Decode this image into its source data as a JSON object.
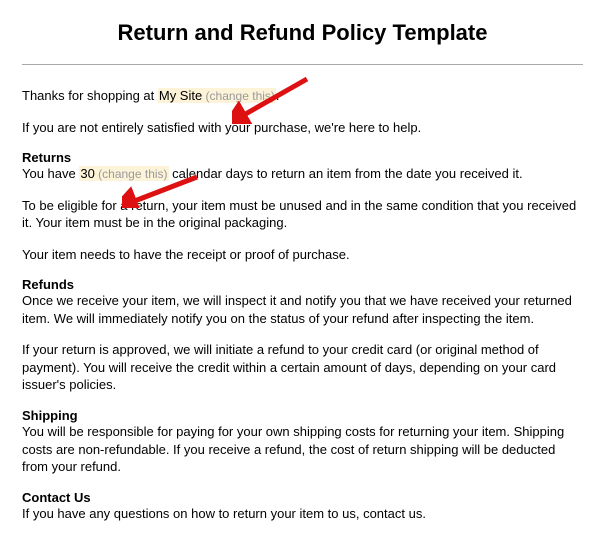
{
  "title": "Return and Refund Policy Template",
  "intro": {
    "prefix": "Thanks for shopping at ",
    "site_name": "My Site",
    "change_hint": " (change this)",
    "suffix": "."
  },
  "satisfaction": "If you are not entirely satisfied with your purchase, we're here to help.",
  "returns": {
    "heading": "Returns",
    "line1_prefix": "You have ",
    "days": "30",
    "change_hint": " (change this)",
    "line1_suffix": " calendar days to return an item from the date you received it.",
    "line2": "To be eligible for a return, your item must be unused and in the same condition that you received it. Your item must be in the original packaging.",
    "line3": "Your item needs to have the receipt or proof of purchase."
  },
  "refunds": {
    "heading": "Refunds",
    "line1": "Once we receive your item, we will inspect it and notify you that we have received your returned item. We will immediately notify you on the status of your refund after inspecting the item.",
    "line2": "If your return is approved, we will initiate a refund to your credit card (or original method of payment). You will receive the credit within a certain amount of days, depending on your card issuer's policies."
  },
  "shipping": {
    "heading": "Shipping",
    "line1": "You will be responsible for paying for your own shipping costs for returning your item. Shipping costs are non-refundable. If you receive a refund, the cost of return shipping will be deducted from your refund."
  },
  "contact": {
    "heading": "Contact Us",
    "line1": "If you have any questions on how to return your item to us, contact us."
  }
}
